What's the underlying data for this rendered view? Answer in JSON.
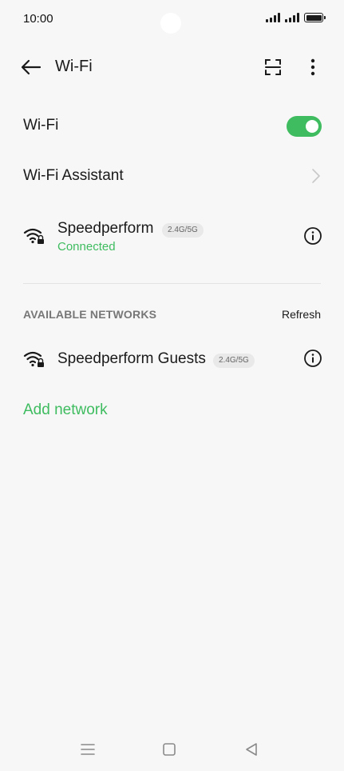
{
  "status_bar": {
    "time": "10:00",
    "icons": [
      "signal-icon",
      "signal-icon",
      "battery-icon"
    ]
  },
  "toolbar": {
    "title": "Wi-Fi",
    "icons": [
      "back-arrow-icon",
      "scan-qr-icon",
      "more-vert-icon"
    ]
  },
  "wifi_toggle": {
    "label": "Wi-Fi",
    "enabled": true,
    "accent": "#3ebc5f"
  },
  "wifi_assistant": {
    "label": "Wi-Fi Assistant"
  },
  "connected_network": {
    "name": "Speedperform",
    "band": "2.4G/5G",
    "status": "Connected"
  },
  "available": {
    "header": "AVAILABLE NETWORKS",
    "refresh_label": "Refresh",
    "networks": [
      {
        "name": "Speedperform Guests",
        "band": "2.4G/5G"
      }
    ]
  },
  "add_network_label": "Add network",
  "nav_bar": {
    "icons": [
      "menu-icon",
      "home-icon",
      "back-triangle-icon"
    ]
  }
}
